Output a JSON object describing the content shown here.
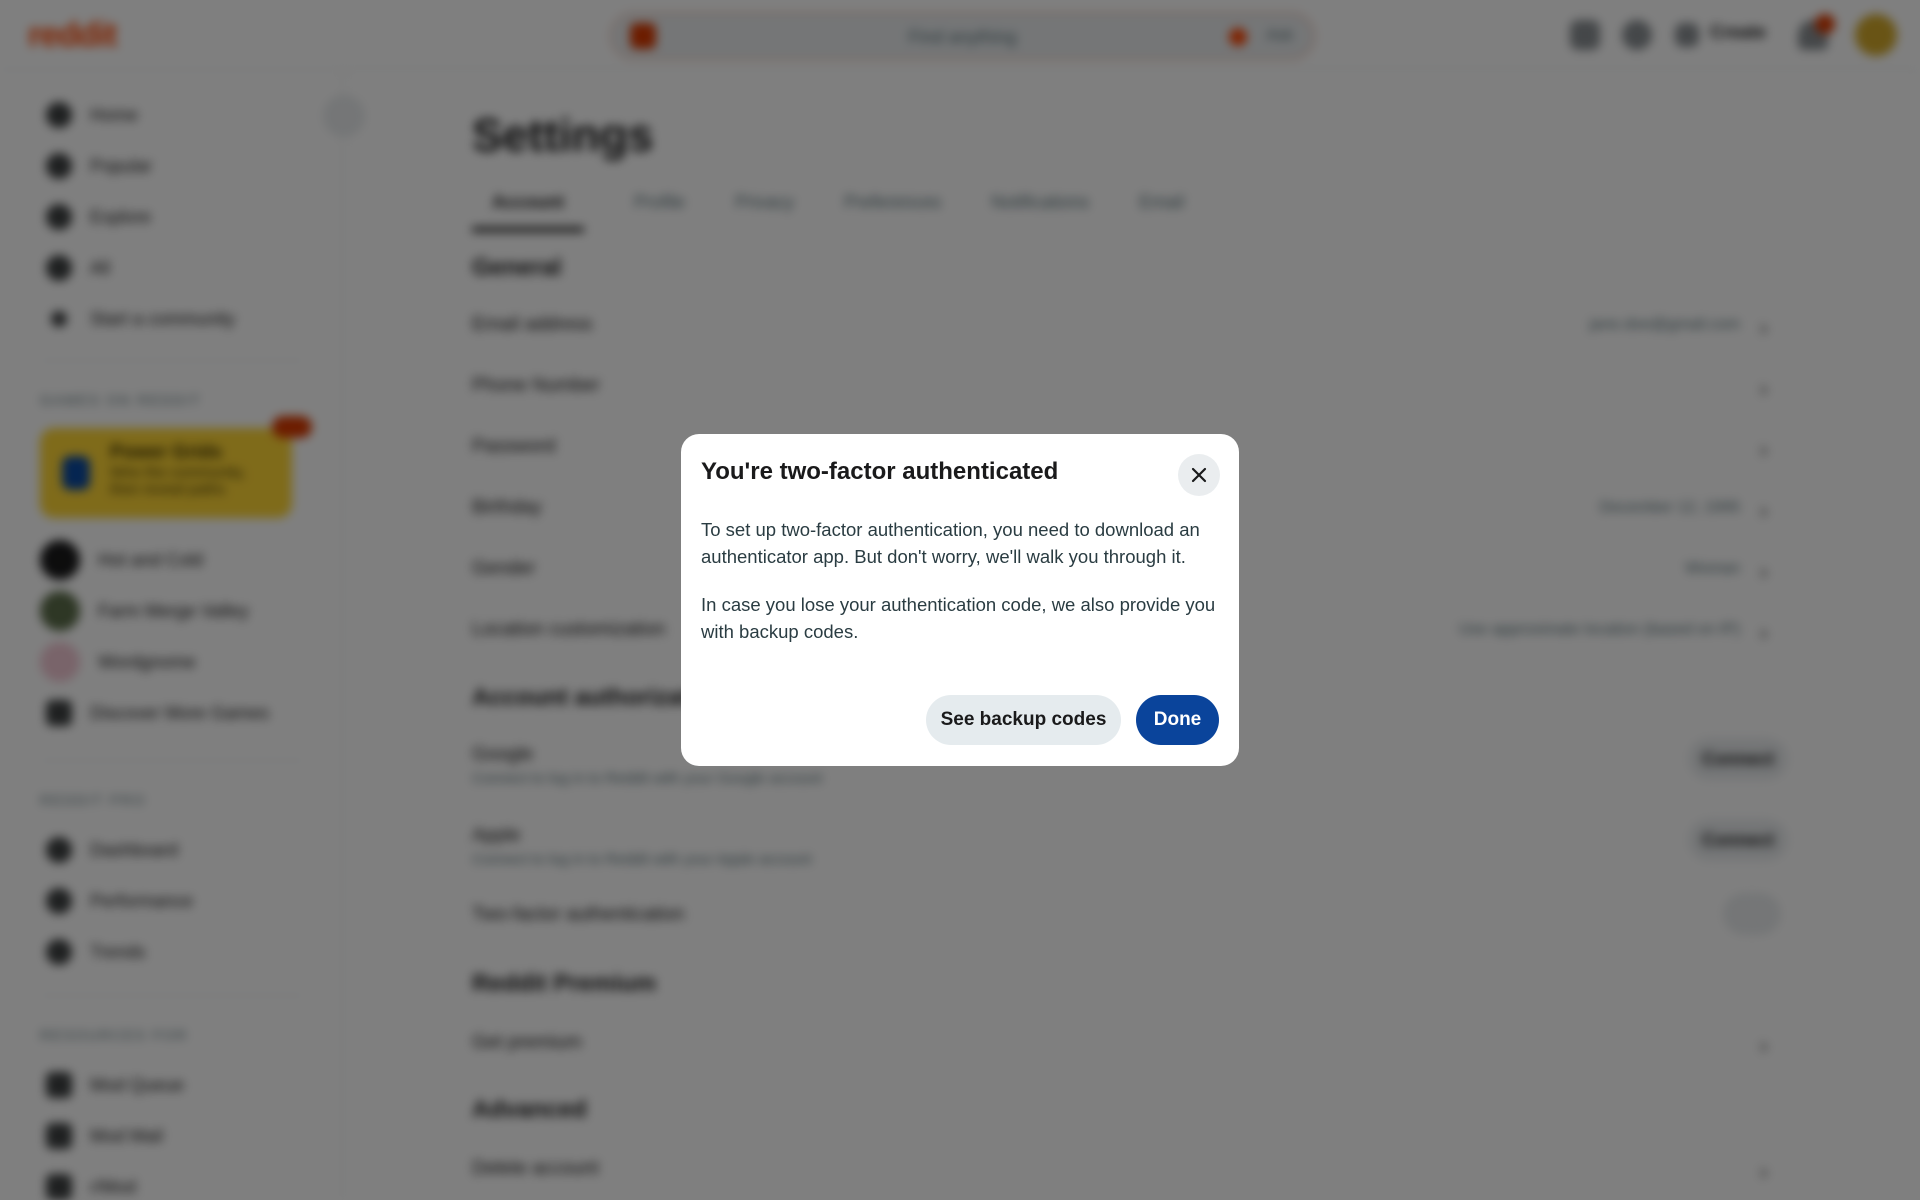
{
  "topbar": {
    "logo": "reddit",
    "search_placeholder": "Find anything",
    "ask_label": "Ask",
    "create_label": "Create"
  },
  "sidebar": {
    "nav": [
      "Home",
      "Popular",
      "Explore",
      "All",
      "Start a community"
    ],
    "section_games": "GAMES ON REDDIT",
    "power_card": {
      "title": "Power Grids",
      "line1": "Wire the community,",
      "line2": "then reveal paths"
    },
    "games": [
      "Hot and Cold",
      "Farm Merge Valley",
      "Wordgnome",
      "Discover More Games"
    ],
    "section_mods": "REDDIT PRO",
    "mods": [
      "Dashboard",
      "Performance",
      "Trends"
    ],
    "section_resources": "RESOURCES FOR",
    "resources": [
      "Mod Queue",
      "Mod Mail",
      "r/Mod"
    ]
  },
  "main": {
    "title": "Settings",
    "tabs": [
      "Account",
      "Profile",
      "Privacy",
      "Preferences",
      "Notifications",
      "Email"
    ],
    "general_heading": "General",
    "general_rows": [
      {
        "label": "Email address",
        "value": "jane.doe@gmail.com"
      },
      {
        "label": "Phone Number",
        "value": ""
      },
      {
        "label": "Password",
        "value": ""
      },
      {
        "label": "Birthday",
        "value": "December 12, 1995"
      },
      {
        "label": "Gender",
        "value": "Woman"
      },
      {
        "label": "Location customization",
        "value": "Use approximate location (based on IP)"
      }
    ],
    "auth_heading": "Account authorization",
    "auth_rows": [
      {
        "label": "Google",
        "sub": "Connect to log in to Reddit with your Google account",
        "action": "Connect"
      },
      {
        "label": "Apple",
        "sub": "Connect to log in to Reddit with your Apple account",
        "action": "Connect"
      }
    ],
    "two_factor_label": "Two-factor authentication",
    "premium_heading": "Reddit Premium",
    "premium_row": "Get premium",
    "advanced_heading": "Advanced",
    "advanced_row": "Delete account"
  },
  "modal": {
    "title": "You're two-factor authenticated",
    "para1": "To set up two-factor authentication, you need to download an authenticator app. But don't worry, we'll walk you through it.",
    "para2": "In case you lose your authentication code, we also provide you with backup codes.",
    "secondary_button": "See backup codes",
    "primary_button": "Done"
  }
}
